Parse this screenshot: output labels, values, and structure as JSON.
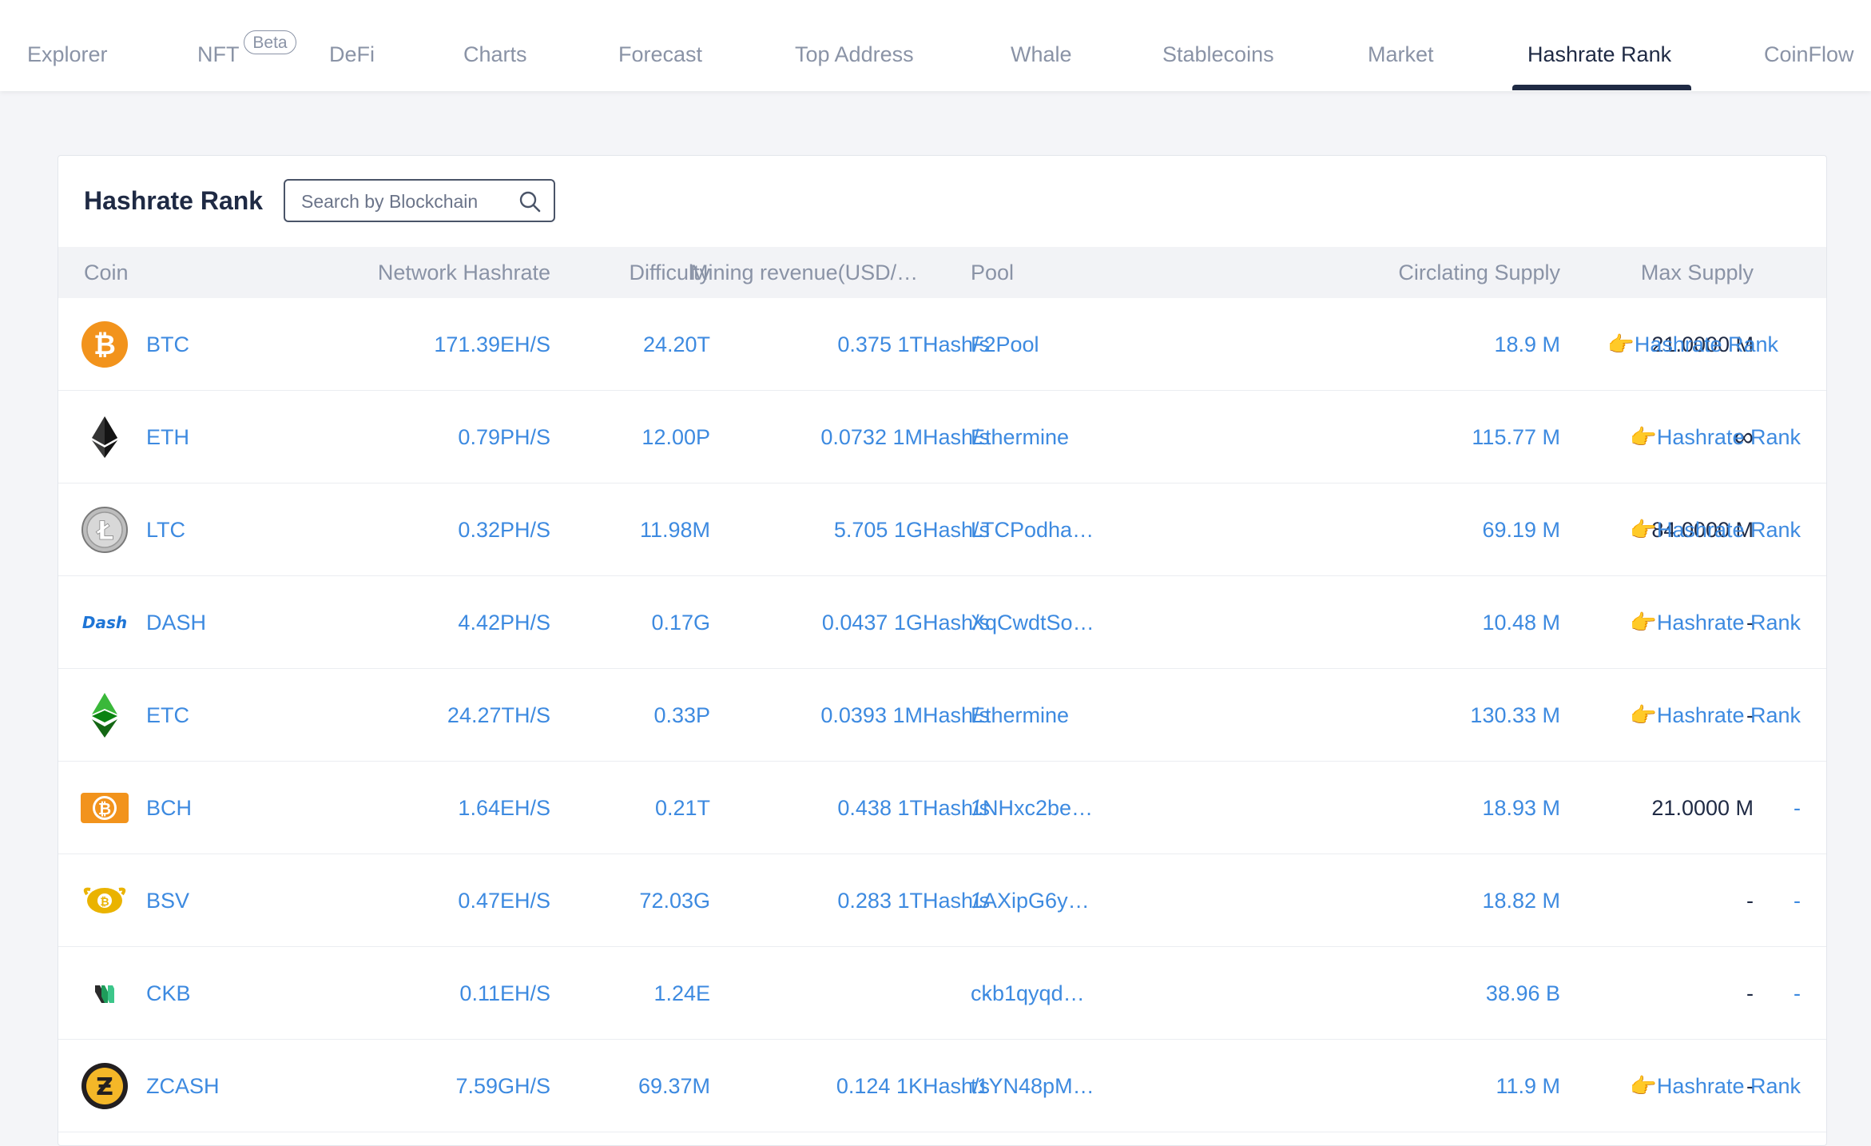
{
  "nav": {
    "items": [
      {
        "label": "Explorer"
      },
      {
        "label": "NFT"
      },
      {
        "label": "DeFi"
      },
      {
        "label": "Charts"
      },
      {
        "label": "Forecast"
      },
      {
        "label": "Top Address"
      },
      {
        "label": "Whale"
      },
      {
        "label": "Stablecoins"
      },
      {
        "label": "Market"
      },
      {
        "label": "Hashrate Rank"
      },
      {
        "label": "CoinFlow"
      }
    ],
    "beta_badge": "Beta",
    "active": "Hashrate Rank"
  },
  "card": {
    "title": "Hashrate Rank",
    "search_placeholder": "Search by Blockchain"
  },
  "table": {
    "headers": {
      "coin": "Coin",
      "hashrate": "Network Hashrate",
      "difficulty": "Difficulty",
      "revenue": "Mining revenue(USD/…",
      "pool": "Pool",
      "supply": "Circlating Supply",
      "max_supply": "Max Supply"
    },
    "rows": [
      {
        "coin": "BTC",
        "icon": "btc-icon",
        "hashrate": "171.39EH/S",
        "difficulty": "24.20T",
        "revenue": "0.375 1THash/s",
        "pool": "F2Pool",
        "supply": "18.9 M",
        "max_supply": "21.0000 M",
        "rank": "👉Hashrate Rank"
      },
      {
        "coin": "ETH",
        "icon": "eth-icon",
        "hashrate": "0.79PH/S",
        "difficulty": "12.00P",
        "revenue": "0.0732 1MHash/s",
        "pool": "Ethermine",
        "supply": "115.77 M",
        "max_supply": "∞",
        "rank": "👉Hashrate Rank"
      },
      {
        "coin": "LTC",
        "icon": "ltc-icon",
        "hashrate": "0.32PH/S",
        "difficulty": "11.98M",
        "revenue": "5.705 1GHash/s",
        "pool": "LTCPodha…",
        "supply": "69.19 M",
        "max_supply": "84.0000 M",
        "rank": "👉Hashrate Rank"
      },
      {
        "coin": "DASH",
        "icon": "dash-icon",
        "hashrate": "4.42PH/S",
        "difficulty": "0.17G",
        "revenue": "0.0437 1GHash/s",
        "pool": "XqCwdtSo…",
        "supply": "10.48 M",
        "max_supply": "-",
        "rank": "👉Hashrate Rank"
      },
      {
        "coin": "ETC",
        "icon": "etc-icon",
        "hashrate": "24.27TH/S",
        "difficulty": "0.33P",
        "revenue": "0.0393 1MHash/s",
        "pool": "Ethermine",
        "supply": "130.33 M",
        "max_supply": "-",
        "rank": "👉Hashrate Rank"
      },
      {
        "coin": "BCH",
        "icon": "bch-icon",
        "hashrate": "1.64EH/S",
        "difficulty": "0.21T",
        "revenue": "0.438 1THash/s",
        "pool": "1NHxc2be…",
        "supply": "18.93 M",
        "max_supply": "21.0000 M",
        "rank": "-"
      },
      {
        "coin": "BSV",
        "icon": "bsv-icon",
        "hashrate": "0.47EH/S",
        "difficulty": "72.03G",
        "revenue": "0.283 1THash/s",
        "pool": "1AXipG6y…",
        "supply": "18.82 M",
        "max_supply": "-",
        "rank": "-"
      },
      {
        "coin": "CKB",
        "icon": "ckb-icon",
        "hashrate": "0.11EH/S",
        "difficulty": "1.24E",
        "revenue": "-",
        "pool": "ckb1qyqd…",
        "supply": "38.96 B",
        "max_supply": "-",
        "rank": "-"
      },
      {
        "coin": "ZCASH",
        "icon": "zcash-icon",
        "hashrate": "7.59GH/S",
        "difficulty": "69.37M",
        "revenue": "0.124 1KHash/s",
        "pool": "t1YN48pM…",
        "supply": "11.9 M",
        "max_supply": "-",
        "rank": "👉Hashrate Rank"
      }
    ]
  },
  "colors": {
    "link": "#3d8ae0",
    "text_dark": "#1f2a44",
    "text_muted": "#8a93a6",
    "btc": "#f2931c",
    "bch": "#f2931c",
    "dash": "#1e75d6",
    "etc": "#3ab83a",
    "zcash": "#f4b728"
  }
}
